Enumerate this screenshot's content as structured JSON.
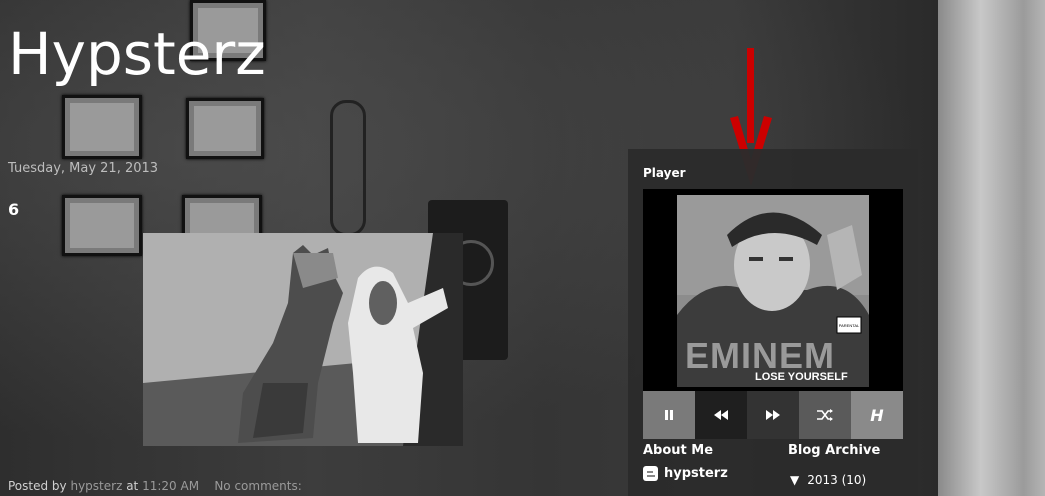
{
  "blog": {
    "title": "Hypsterz"
  },
  "post": {
    "date": "Tuesday, May 21, 2013",
    "title": "6",
    "image_alt": "cat and dog",
    "footer": {
      "posted_by_label": "Posted by",
      "author": "hypsterz",
      "at_label": "at",
      "time": "11:20 AM",
      "comments": "No comments:"
    }
  },
  "player": {
    "heading": "Player",
    "album": {
      "artist_logo": "EMINEM",
      "track": "LOSE YOURSELF",
      "advisory": "PARENTAL ADVISORY EXPLICIT CONTENT"
    },
    "controls": {
      "pause": "pause-icon",
      "prev": "rewind-icon",
      "next": "fast-forward-icon",
      "shuffle": "shuffle-icon",
      "brand_label": "H"
    }
  },
  "about": {
    "heading": "About Me",
    "profile_name": "hypsterz"
  },
  "archive": {
    "heading": "Blog Archive",
    "toggle": "▼",
    "year": "2013",
    "count": "(10)"
  },
  "colors": {
    "arrow": "#cc0000",
    "panel": "#2b2b2b",
    "link": "#9a9a9a"
  }
}
